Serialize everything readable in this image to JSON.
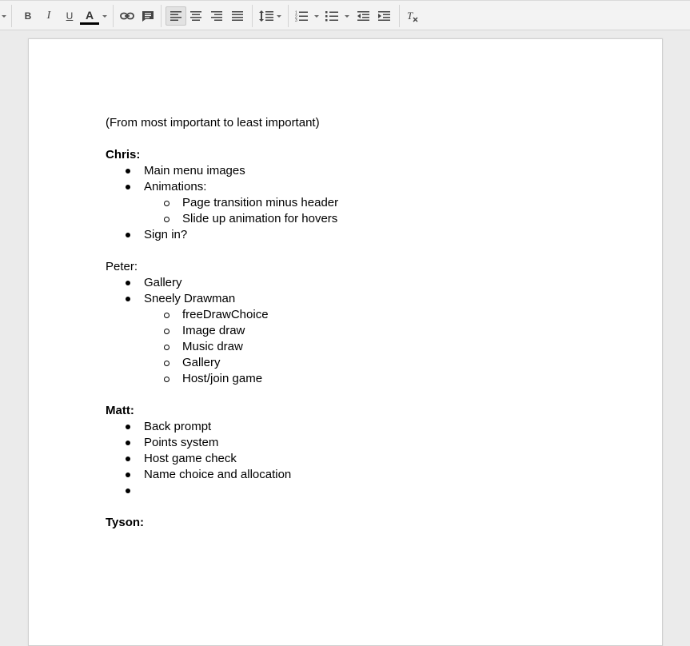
{
  "toolbar": {
    "bold": "B",
    "italic": "I",
    "underline": "U",
    "text_color": "A",
    "text_color_value": "#000000",
    "icons": [
      "dropdown-caret-icon",
      "link-icon",
      "comment-icon",
      "align-left-icon",
      "align-center-icon",
      "align-right-icon",
      "justify-icon",
      "line-spacing-icon",
      "numbered-list-icon",
      "bulleted-list-icon",
      "decrease-indent-icon",
      "increase-indent-icon",
      "clear-formatting-icon"
    ]
  },
  "document": {
    "intro": "(From most important to least important)",
    "sections": [
      {
        "name": "Chris:",
        "bold": true,
        "items": [
          {
            "text": "Main menu images"
          },
          {
            "text": "Animations:",
            "children": [
              "Page transition minus header",
              "Slide up animation for hovers"
            ]
          },
          {
            "text": "Sign in?"
          }
        ]
      },
      {
        "name": "Peter:",
        "bold": false,
        "items": [
          {
            "text": "Gallery"
          },
          {
            "text": "Sneely Drawman",
            "children": [
              "freeDrawChoice",
              "Image draw",
              "Music draw",
              "Gallery",
              "Host/join game"
            ]
          }
        ]
      },
      {
        "name": "Matt:",
        "bold": true,
        "items": [
          {
            "text": "Back prompt"
          },
          {
            "text": "Points system"
          },
          {
            "text": "Host game check"
          },
          {
            "text": "Name choice and allocation"
          },
          {
            "text": ""
          }
        ]
      },
      {
        "name": "Tyson:",
        "bold": true,
        "items": []
      }
    ]
  }
}
